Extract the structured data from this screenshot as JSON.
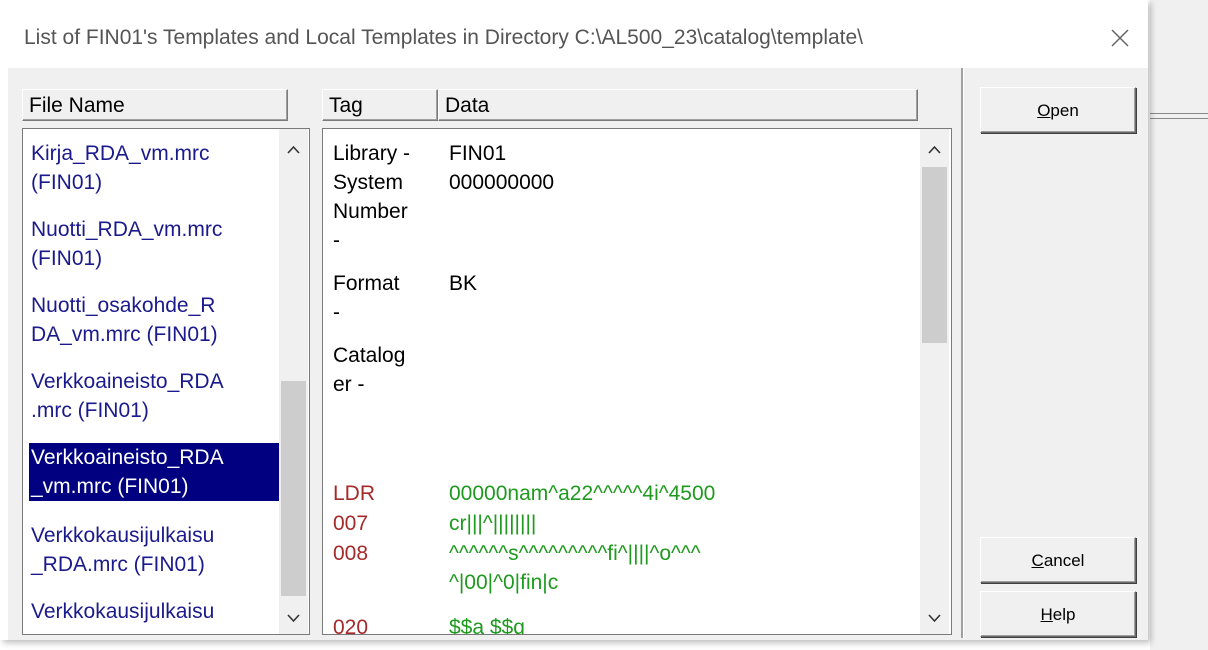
{
  "window": {
    "title": "List of FIN01's Templates and Local Templates in Directory C:\\AL500_23\\catalog\\template\\",
    "close_icon": "close-icon"
  },
  "file_list": {
    "header": "File Name",
    "items": [
      {
        "line1": "Kirja_RDA_vm.mrc",
        "line2": "(FIN01)"
      },
      {
        "line1": "Nuotti_RDA_vm.mrc",
        "line2": "(FIN01)"
      },
      {
        "line1": "Nuotti_osakohde_R",
        "line2": "DA_vm.mrc (FIN01)"
      },
      {
        "line1": "Verkkoaineisto_RDA",
        "line2": ".mrc (FIN01)"
      },
      {
        "line1": "Verkkoaineisto_RDA",
        "line2": "_vm.mrc (FIN01)",
        "selected": true
      },
      {
        "line1": "Verkkokausijulkaisu",
        "line2": "_RDA.mrc (FIN01)"
      },
      {
        "line1": "Verkkokausijulkaisu",
        "line2": ""
      }
    ],
    "scroll_up_icon": "chevron-up-icon",
    "scroll_down_icon": "chevron-down-icon"
  },
  "details": {
    "tag_header": "Tag",
    "data_header": "Data",
    "meta": [
      {
        "tag": [
          "Library -"
        ],
        "data": "FIN01"
      },
      {
        "tag": [
          "System",
          "Number",
          "-"
        ],
        "data": "000000000"
      },
      {
        "tag": [
          "Format",
          "-"
        ],
        "data": "BK"
      },
      {
        "tag": [
          "Catalog",
          "er -"
        ],
        "data": ""
      }
    ],
    "fields": [
      {
        "tag": "LDR",
        "data": [
          "00000nam^a22^^^^^4i^4500"
        ]
      },
      {
        "tag": "007",
        "data": [
          "cr|||^||||||||"
        ]
      },
      {
        "tag": "008",
        "data": [
          "^^^^^^s^^^^^^^^^fi^||||^o^^^",
          "^|00|^0|fin|c"
        ]
      },
      {
        "tag": "020",
        "data": [
          "$$a $$q"
        ]
      }
    ]
  },
  "buttons": {
    "open": {
      "prefix": "",
      "mnemonic": "O",
      "rest": "pen"
    },
    "cancel": {
      "prefix": "",
      "mnemonic": "C",
      "rest": "ancel"
    },
    "help": {
      "prefix": "",
      "mnemonic": "H",
      "rest": "elp"
    }
  }
}
